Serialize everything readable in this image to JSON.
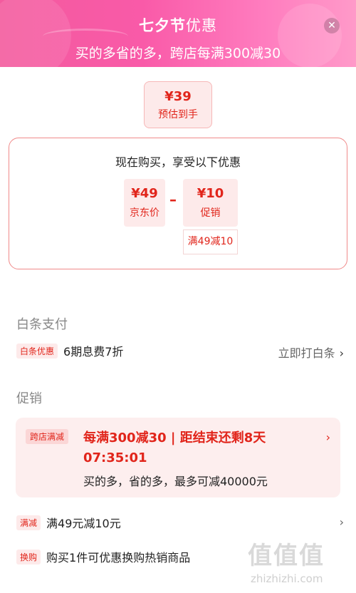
{
  "header": {
    "brand": "七夕节",
    "brand_suffix": "优惠",
    "subtitle": "买的多省的多，跨店每满300减30",
    "close_symbol": "✕"
  },
  "estimate": {
    "price": "¥39",
    "label": "预估到手"
  },
  "breakdown": {
    "title": "现在购买，享受以下优惠",
    "jd_price": {
      "value": "¥49",
      "label": "京东价"
    },
    "operator": "–",
    "promo": {
      "value": "¥10",
      "label": "促销"
    },
    "promo_tag": "满49减10"
  },
  "baitiao": {
    "section_title": "白条支付",
    "badge": "白条优惠",
    "text": "6期息费7折",
    "action": "立即打白条"
  },
  "promotion": {
    "section_title": "促销",
    "card": {
      "badge": "跨店满减",
      "main": "每满300减30 | 距结束还剩8天 07:35:01",
      "desc": "买的多，省的多，最多可减40000元"
    },
    "items": [
      {
        "badge": "满减",
        "text": "满49元减10元"
      },
      {
        "badge": "换购",
        "text": "购买1件可优惠换购热销商品"
      }
    ]
  },
  "watermark": {
    "chars": "值值值",
    "url": "zhizhizhi.com"
  },
  "colors": {
    "accent": "#e1251b",
    "header_pink": "#f95aa8",
    "badge_bg": "#fdeaea"
  }
}
